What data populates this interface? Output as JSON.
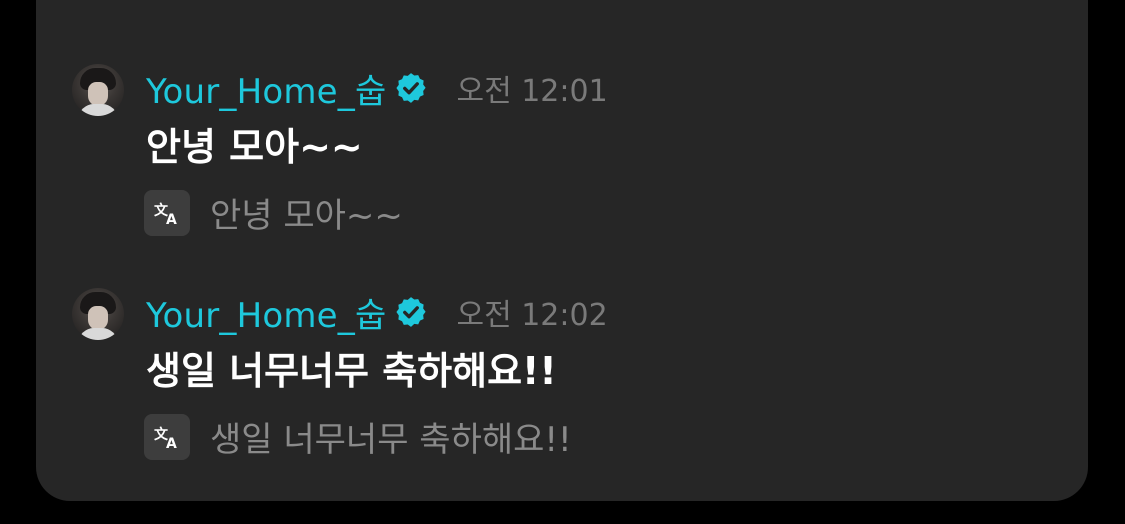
{
  "messages": [
    {
      "username": "Your_Home_숩",
      "time": "오전 12:01",
      "text": "안녕 모아~~",
      "translation": "안녕 모아~~",
      "verified": true
    },
    {
      "username": "Your_Home_숩",
      "time": "오전 12:02",
      "text": "생일 너무너무 축하해요!!",
      "translation": "생일 너무너무 축하해요!!",
      "verified": true
    }
  ],
  "colors": {
    "username": "#1ec8dc",
    "verified_badge": "#1ec8dc",
    "panel_background": "#262626",
    "page_background": "#000000"
  },
  "icons": {
    "verified": "verified-badge-icon",
    "translate": "translate-icon"
  }
}
